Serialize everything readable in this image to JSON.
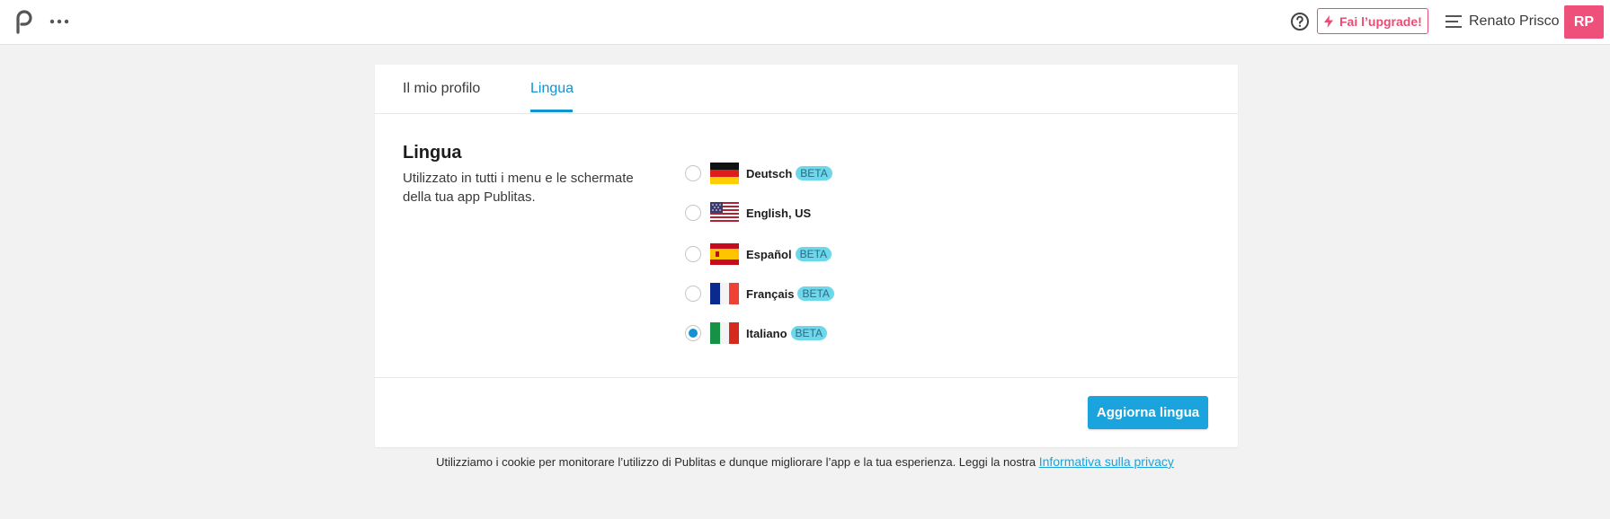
{
  "header": {
    "logo": "publitas-logo",
    "more_icon": "more-dots-icon",
    "help_icon": "help-circle-icon",
    "upgrade_label": "Fai l’upgrade!",
    "menu_icon": "hamburger-menu-icon",
    "user_name": "Renato Prisco",
    "avatar_initials": "RP"
  },
  "tabs": [
    {
      "label": "Il mio profilo",
      "active": false
    },
    {
      "label": "Lingua",
      "active": true
    }
  ],
  "section": {
    "title": "Lingua",
    "description": "Utilizzato in tutti i menu e le schermate della tua app Publitas."
  },
  "languages": [
    {
      "label": "Deutsch",
      "badge": "BETA",
      "flag": "flag-de-icon",
      "selected": false
    },
    {
      "label": "English, US",
      "badge": "",
      "flag": "flag-us-icon",
      "selected": false
    },
    {
      "label": "Español",
      "badge": "BETA",
      "flag": "flag-es-icon",
      "selected": false
    },
    {
      "label": "Français",
      "badge": "BETA",
      "flag": "flag-fr-icon",
      "selected": false
    },
    {
      "label": "Italiano",
      "badge": "BETA",
      "flag": "flag-it-icon",
      "selected": true
    }
  ],
  "submit_label": "Aggiorna lingua",
  "footer": {
    "text": "Utilizziamo i cookie per monitorare l’utilizzo di Publitas e dunque migliorare l’app e la tua esperienza. Leggi la nostra",
    "link": "Informativa sulla privacy"
  },
  "colors": {
    "accent": "#1293d2",
    "upgrade": "#ea4c73",
    "avatar": "#ef4f7b",
    "beta_badge": "#6dd8ea",
    "background": "#f2f2f2"
  }
}
